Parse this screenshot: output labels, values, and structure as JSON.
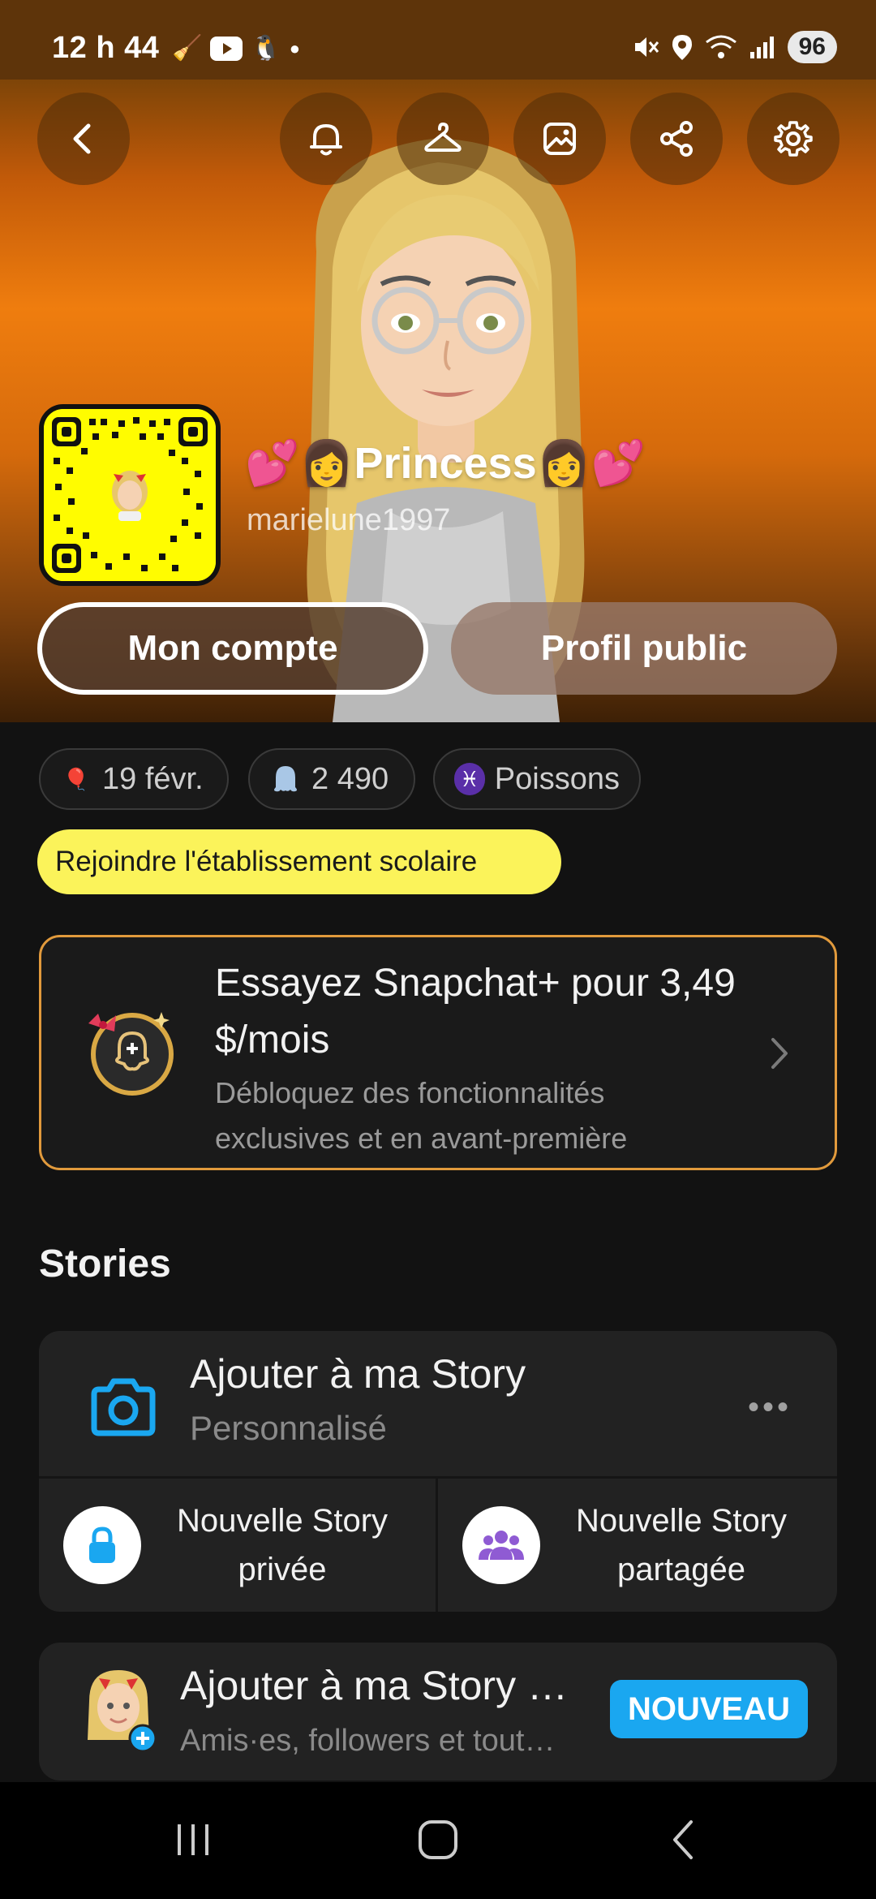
{
  "status_bar": {
    "time": "12 h 44",
    "battery": "96"
  },
  "profile": {
    "display_name": "💕👩Princess👩💕",
    "username": "marielune1997",
    "my_account_label": "Mon compte",
    "public_profile_label": "Profil public"
  },
  "chips": {
    "birthday": "19 févr.",
    "score": "2 490",
    "zodiac": "Poissons",
    "school": "Rejoindre l'établissement scolaire"
  },
  "promo": {
    "title": "Essayez Snapchat+ pour 3,49 $/mois",
    "description": "Débloquez des fonctionnalités exclusives et en avant-première"
  },
  "stories": {
    "section_title": "Stories",
    "add_title": "Ajouter à ma Story",
    "add_sub": "Personnalisé",
    "more": "•••",
    "private_label": "Nouvelle Story privée",
    "shared_label": "Nouvelle Story partagée",
    "add2_title": "Ajouter à ma Story …",
    "add2_sub": "Amis·es, followers et tout…",
    "new_badge": "NOUVEAU"
  },
  "colors": {
    "accent_blue": "#1aa7f0",
    "snap_yellow": "#fffc00",
    "promo_border": "#e19a3c",
    "zodiac_purple": "#5a2fa8"
  },
  "icons": [
    "back-icon",
    "bell-icon",
    "hanger-icon",
    "image-icon",
    "share-icon",
    "gear-icon",
    "camera-icon",
    "lock-icon",
    "group-icon",
    "chevron-right-icon"
  ]
}
